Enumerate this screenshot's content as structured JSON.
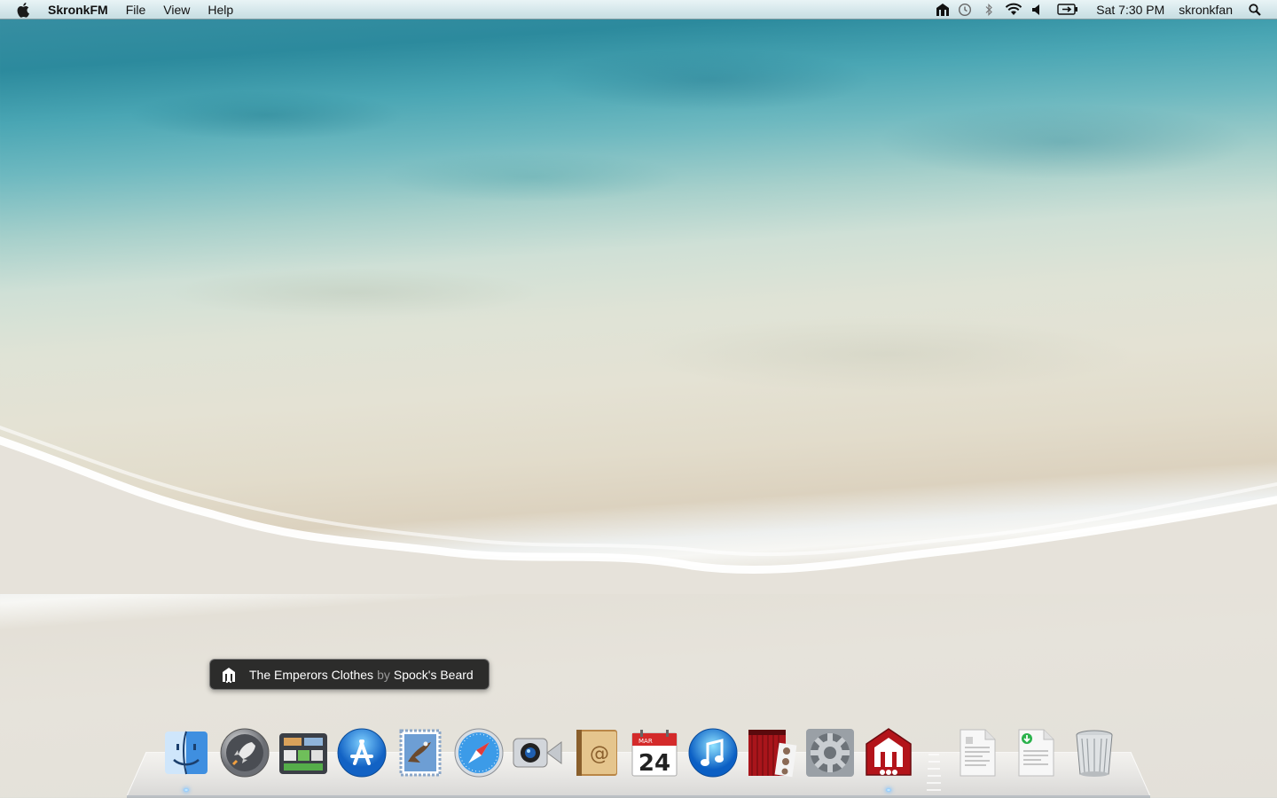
{
  "menubar": {
    "app_name": "SkronkFM",
    "menus": [
      "File",
      "View",
      "Help"
    ],
    "clock": "Sat 7:30 PM",
    "user": "skronkfan",
    "status_icons": [
      "skronkfm-icon",
      "time-machine-icon",
      "bluetooth-icon",
      "wifi-icon",
      "volume-icon",
      "battery-icon",
      "spotlight-icon"
    ]
  },
  "notification": {
    "track": "The Emperors Clothes",
    "by": "by",
    "artist": "Spock's Beard"
  },
  "dock": {
    "apps": [
      "Finder",
      "Launchpad",
      "Mission Control",
      "App Store",
      "Mail",
      "Safari",
      "FaceTime",
      "Address Book",
      "iCal",
      "iTunes",
      "Photo Booth",
      "System Preferences",
      "SkronkFM"
    ],
    "right": [
      "Documents",
      "Downloads",
      "Trash"
    ],
    "calendar": {
      "month": "MAR",
      "day": "24"
    }
  },
  "colors": {
    "menubar": "#d7e9ec",
    "notification_bg": "#1c1c1c",
    "skronk_red": "#b3141a",
    "running_indicator": "#7ec3ff"
  }
}
